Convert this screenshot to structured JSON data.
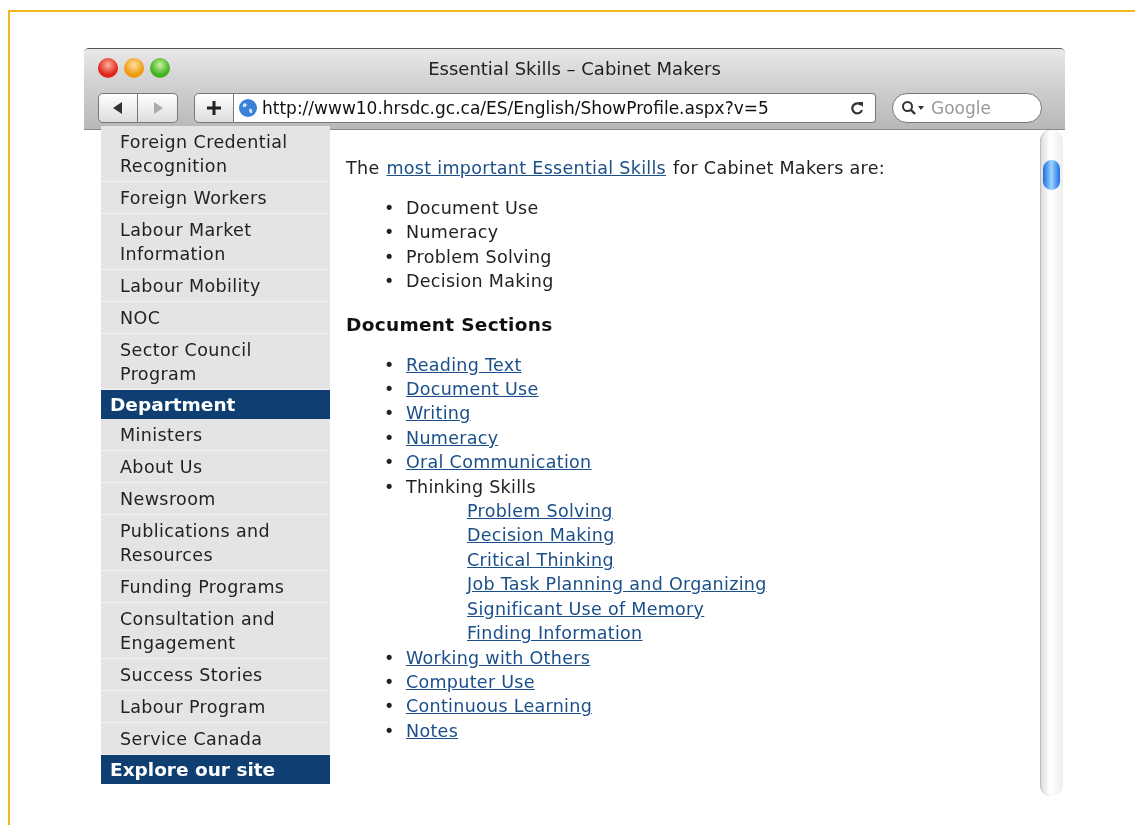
{
  "window": {
    "title": "Essential Skills – Cabinet Makers"
  },
  "toolbar": {
    "url": "http://www10.hrsdc.gc.ca/ES/English/ShowProfile.aspx?v=5",
    "search": {
      "placeholder": "Google"
    }
  },
  "sidebar": {
    "items": [
      {
        "kind": "link",
        "label": "Foreign Credential Recognition"
      },
      {
        "kind": "link",
        "label": "Foreign Workers"
      },
      {
        "kind": "link",
        "label": "Labour Market Information"
      },
      {
        "kind": "link",
        "label": "Labour Mobility"
      },
      {
        "kind": "link",
        "label": "NOC"
      },
      {
        "kind": "link",
        "label": "Sector Council Program"
      },
      {
        "kind": "heading",
        "label": "Department"
      },
      {
        "kind": "link",
        "label": "Ministers"
      },
      {
        "kind": "link",
        "label": "About Us"
      },
      {
        "kind": "link",
        "label": "Newsroom"
      },
      {
        "kind": "link",
        "label": "Publications and Resources"
      },
      {
        "kind": "link",
        "label": "Funding Programs"
      },
      {
        "kind": "link",
        "label": "Consultation and Engagement"
      },
      {
        "kind": "link",
        "label": "Success Stories"
      },
      {
        "kind": "link",
        "label": "Labour Program"
      },
      {
        "kind": "link",
        "label": "Service Canada"
      },
      {
        "kind": "heading",
        "label": "Explore our site"
      }
    ]
  },
  "content": {
    "intro": {
      "before": "The",
      "link": "most important Essential Skills",
      "after": "for Cabinet Makers are:"
    },
    "skills": [
      {
        "bullet": "•",
        "label": "Document Use"
      },
      {
        "bullet": "•",
        "label": "Numeracy"
      },
      {
        "bullet": "•",
        "label": "Problem Solving"
      },
      {
        "bullet": "•",
        "label": "Decision Making"
      }
    ],
    "sections_heading": "Document Sections",
    "sections": [
      {
        "kind": "link",
        "bullet": "•",
        "label": "Reading Text"
      },
      {
        "kind": "link",
        "bullet": "•",
        "label": "Document Use"
      },
      {
        "kind": "link",
        "bullet": "•",
        "label": "Writing"
      },
      {
        "kind": "link",
        "bullet": "•",
        "label": "Numeracy"
      },
      {
        "kind": "link",
        "bullet": "•",
        "label": "Oral Communication"
      },
      {
        "kind": "text",
        "bullet": "•",
        "label": "Thinking Skills",
        "children": [
          {
            "kind": "link",
            "label": "Problem Solving"
          },
          {
            "kind": "link",
            "label": "Decision Making"
          },
          {
            "kind": "link",
            "label": "Critical Thinking"
          },
          {
            "kind": "link",
            "label": "Job Task Planning and Organizing"
          },
          {
            "kind": "link",
            "label": "Significant Use of Memory"
          },
          {
            "kind": "link",
            "label": "Finding Information"
          }
        ]
      },
      {
        "kind": "link",
        "bullet": "•",
        "label": "Working with Others"
      },
      {
        "kind": "link",
        "bullet": "•",
        "label": "Computer Use"
      },
      {
        "kind": "link",
        "bullet": "•",
        "label": "Continuous Learning"
      },
      {
        "kind": "link",
        "bullet": "•",
        "label": "Notes"
      }
    ]
  }
}
